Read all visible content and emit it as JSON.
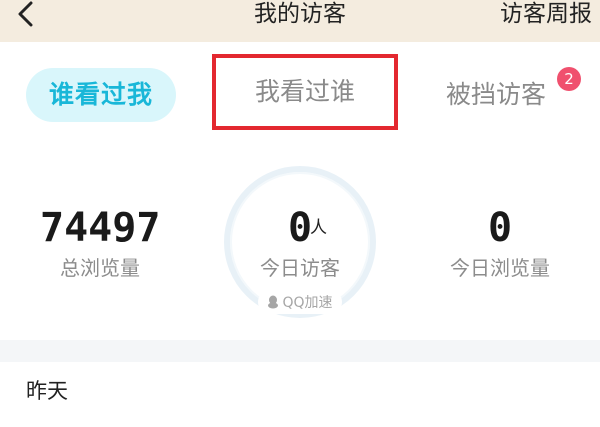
{
  "header": {
    "title": "我的访客",
    "weekly_report": "访客周报",
    "back_icon": "chevron-left-icon"
  },
  "tabs": [
    {
      "label": "谁看过我",
      "active": true
    },
    {
      "label": "我看过谁",
      "active": false,
      "highlighted": true
    },
    {
      "label": "被挡访客",
      "active": false,
      "badge": "2"
    }
  ],
  "stats": {
    "total_views": {
      "value": "74497",
      "label": "总浏览量"
    },
    "today_visitors": {
      "value": "0",
      "unit": "人",
      "label": "今日访客",
      "boost": "QQ加速"
    },
    "today_views": {
      "value": "0",
      "label": "今日浏览量"
    }
  },
  "list": {
    "section_title": "昨天"
  },
  "colors": {
    "header_bg": "#f4ecdf",
    "active_tab_bg": "#d9f6fb",
    "active_tab_text": "#19b7d8",
    "highlight_border": "#e3282f",
    "badge_bg": "#f0506e"
  }
}
